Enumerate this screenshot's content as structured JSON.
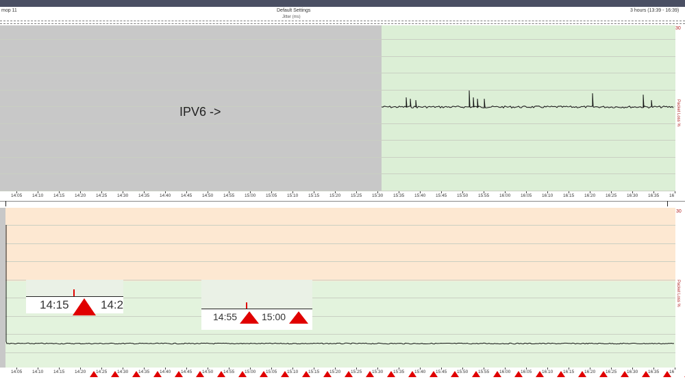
{
  "header": {
    "left": "mop 11",
    "center": "Default Settings",
    "right": "3 hours (13:39 - 16:39)",
    "sub": "Jitter (ms)"
  },
  "top_chart": {
    "overlay_text": "IPV6 ->",
    "y_axis_label": "Packet Loss %",
    "y_max_label": "30",
    "gray_background": "#c8c8c8",
    "green_background": "#dcefd6"
  },
  "bottom_chart": {
    "y_axis_label": "Packet Loss %",
    "y_max_label": "30",
    "orange_background": "#fde8d2",
    "green_background": "#e3f3dd"
  },
  "time_ticks": [
    "14:05",
    "14:10",
    "14:15",
    "14:20",
    "14:25",
    "14:30",
    "14:35",
    "14:40",
    "14:45",
    "14:50",
    "14:55",
    "15:00",
    "15:05",
    "15:10",
    "15:15",
    "15:20",
    "15:25",
    "15:30",
    "15:35",
    "15:40",
    "15:45",
    "15:50",
    "15:55",
    "16:00",
    "16:05",
    "16:10",
    "16:15",
    "16:20",
    "16:25",
    "16:30",
    "16:35",
    "16"
  ],
  "zoom1": {
    "t1": "14:15",
    "t2": "14:2"
  },
  "zoom2": {
    "t1": "14:55",
    "t2": "15:00"
  },
  "colors": {
    "alert": "#e00000",
    "line": "#111111",
    "axis_label": "#b02020"
  }
}
